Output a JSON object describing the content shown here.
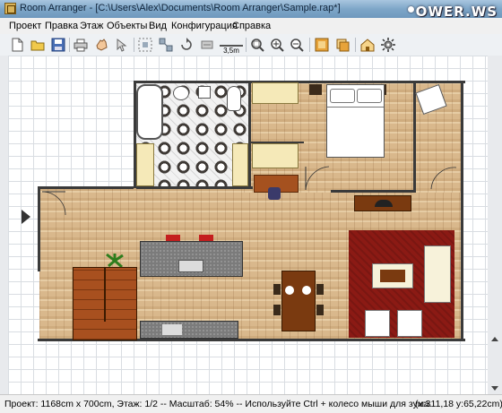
{
  "window": {
    "title": "Room Arranger - [C:\\Users\\Alex\\Documents\\Room Arranger\\Sample.rap*]",
    "watermark": "OWER.WS"
  },
  "menu": {
    "items": [
      "Проект",
      "Правка",
      "Этаж",
      "Объекты",
      "Вид",
      "Конфигурация",
      "Справка"
    ]
  },
  "toolbar": {
    "buttons": [
      {
        "icon": "new-file-icon"
      },
      {
        "icon": "open-folder-icon"
      },
      {
        "icon": "save-icon"
      },
      {
        "icon": "print-icon"
      },
      {
        "icon": "hand-pan-icon"
      },
      {
        "icon": "pointer-icon"
      },
      {
        "icon": "select-area-icon"
      },
      {
        "icon": "multi-select-icon"
      },
      {
        "icon": "rotate-icon"
      },
      {
        "icon": "measure-icon"
      },
      {
        "icon": "zoom-fit-icon"
      },
      {
        "icon": "zoom-in-icon"
      },
      {
        "icon": "zoom-out-icon"
      },
      {
        "icon": "view-2d-icon"
      },
      {
        "icon": "view-objects-icon"
      },
      {
        "icon": "3d-view-icon"
      },
      {
        "icon": "settings-icon"
      }
    ],
    "measure_label": "3,5m"
  },
  "status": {
    "info": "Проект: 1168cm x 700cm, Этаж: 1/2 -- Масштаб: 54% -- Используйте Ctrl + колесо мыши для зума.",
    "coords": "(x:311,18 y:65,22cm)"
  },
  "colors": {
    "floor_wood": "#d9b88c",
    "rug": "#8b1a14",
    "stairs": "#a8501f",
    "wall": "#3a3a3a"
  }
}
